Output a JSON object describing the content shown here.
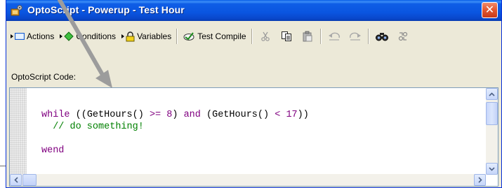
{
  "window": {
    "title": "OptoScript - Powerup - Test Hour"
  },
  "titlebar": {
    "close_glyph": "✕"
  },
  "toolbar": {
    "actions_label": "Actions",
    "conditions_label": "Conditions",
    "variables_label": "Variables",
    "test_compile_label": "Test Compile",
    "icons": [
      "cut-icon",
      "copy-icon",
      "paste-icon",
      "undo-icon",
      "redo-icon",
      "find-icon",
      "find-replace-icon"
    ]
  },
  "editor": {
    "label": "OptoScript Code:",
    "code_lines": [
      {
        "parts": [
          {
            "t": "while",
            "c": "kw"
          },
          {
            "t": " ((",
            "c": "fn"
          },
          {
            "t": "GetHours",
            "c": "fn"
          },
          {
            "t": "() ",
            "c": "fn"
          },
          {
            "t": ">=",
            "c": "op"
          },
          {
            "t": " ",
            "c": "fn"
          },
          {
            "t": "8",
            "c": "num"
          },
          {
            "t": ") ",
            "c": "fn"
          },
          {
            "t": "and",
            "c": "kw"
          },
          {
            "t": " (",
            "c": "fn"
          },
          {
            "t": "GetHours",
            "c": "fn"
          },
          {
            "t": "() ",
            "c": "fn"
          },
          {
            "t": "<",
            "c": "op"
          },
          {
            "t": " ",
            "c": "fn"
          },
          {
            "t": "17",
            "c": "num"
          },
          {
            "t": "))",
            "c": "fn"
          }
        ]
      },
      {
        "parts": [
          {
            "t": "  // do something!",
            "c": "cm"
          }
        ]
      },
      {
        "parts": [
          {
            "t": "",
            "c": "fn"
          }
        ]
      },
      {
        "parts": [
          {
            "t": "wend",
            "c": "kw"
          }
        ]
      }
    ]
  },
  "colors": {
    "keyword": "#800080",
    "comment": "#008000",
    "titlebar": "#0a55e0",
    "close": "#e45a32"
  }
}
